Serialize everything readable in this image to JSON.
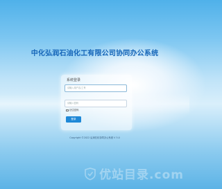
{
  "header": {
    "title": "中化弘润石油化工有限公司协同办公系统"
  },
  "login": {
    "panel_title": "系统登录",
    "username_placeholder": "请输入用户名/工号",
    "password_placeholder": "请输入密码",
    "remember_label": "记住密码",
    "submit_label": "登录"
  },
  "footer": {
    "copyright": "Copyright ©2022 弘润石化协同办公系统 V 5.0"
  },
  "watermark": {
    "text": "优站目录.com"
  },
  "colors": {
    "title": "#1565b8",
    "button": "#1e88d7",
    "background": "#7cc6f1"
  }
}
